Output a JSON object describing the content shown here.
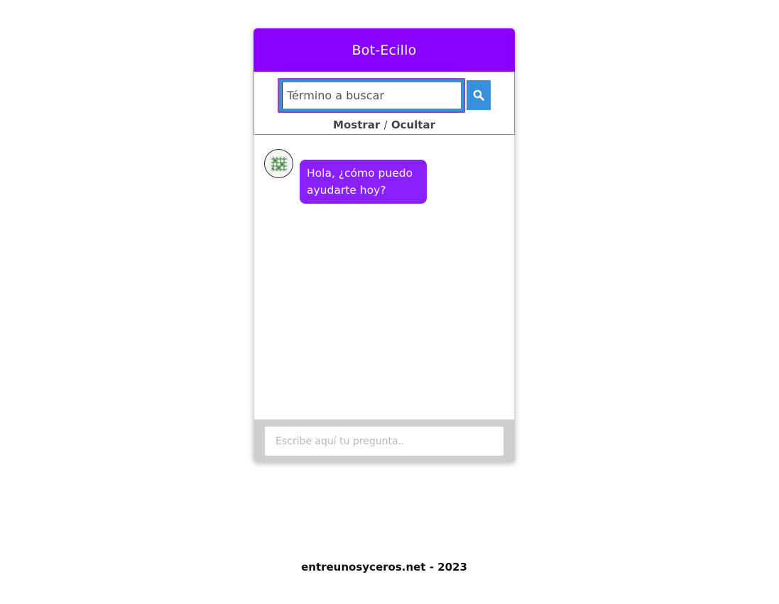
{
  "header": {
    "title": "Bot-Ecillo",
    "background_color": "#8a00ff"
  },
  "search": {
    "placeholder": "Término a buscar",
    "value": "",
    "button_icon": "search-icon",
    "accent_color": "#3a8fdc"
  },
  "toggle": {
    "show_label": "Mostrar",
    "separator": "/",
    "hide_label": "Ocultar"
  },
  "messages": [
    {
      "sender": "bot",
      "avatar_icon": "bot-avatar-icon",
      "text": "Hola, ¿cómo puedo ayudarte hoy?",
      "bubble_color": "#8a1fff"
    }
  ],
  "composer": {
    "placeholder": "Escribe aquí tu pregunta..",
    "value": ""
  },
  "footer": {
    "text": "entreunosyceros.net - 2023"
  }
}
